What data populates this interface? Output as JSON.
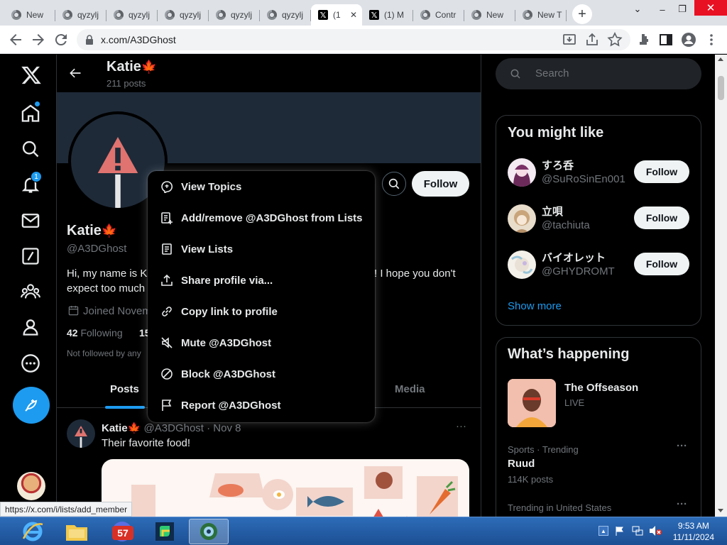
{
  "browser": {
    "tabs": [
      {
        "label": "New",
        "icon": "chrome-icon"
      },
      {
        "label": "qyzylj",
        "icon": "chrome-icon"
      },
      {
        "label": "qyzylj",
        "icon": "chrome-icon"
      },
      {
        "label": "qyzylj",
        "icon": "chrome-icon"
      },
      {
        "label": "qyzylj",
        "icon": "chrome-icon"
      },
      {
        "label": "qyzylj",
        "icon": "chrome-icon"
      },
      {
        "label": "(1",
        "icon": "x-icon",
        "active": true
      },
      {
        "label": "(1) M",
        "icon": "x-icon"
      },
      {
        "label": "Contr",
        "icon": "chrome-icon"
      },
      {
        "label": "New",
        "icon": "chrome-icon"
      },
      {
        "label": "New T",
        "icon": "chrome-icon"
      }
    ],
    "url": "x.com/A3DGhost",
    "status_url": "https://x.com/i/lists/add_member"
  },
  "nav": {
    "notifications_badge": "1"
  },
  "profile": {
    "header_name": "Katie",
    "flag": "🍁",
    "posts_count": "211 posts",
    "name": "Katie",
    "handle": "@A3DGhost",
    "bio_start": "Hi, my name is Ka",
    "bio_end": "! I hope you don't",
    "bio_line2": "expect too much",
    "joined": "Joined Novem",
    "following_count": "42",
    "following_label": "Following",
    "followers_partial": "15",
    "not_followed": "Not followed by any",
    "follow_label": "Follow"
  },
  "profile_tabs": {
    "posts": "Posts",
    "media": "Media"
  },
  "post": {
    "author": "Katie",
    "flag": "🍁",
    "meta": "@A3DGhost · Nov 8",
    "text": "Their favorite food!",
    "more": "···"
  },
  "menu": {
    "items": [
      {
        "label": "View Topics",
        "icon": "topics-icon"
      },
      {
        "label": "Add/remove @A3DGhost from Lists",
        "icon": "list-add-icon"
      },
      {
        "label": "View Lists",
        "icon": "list-icon"
      },
      {
        "label": "Share profile via...",
        "icon": "share-icon"
      },
      {
        "label": "Copy link to profile",
        "icon": "link-icon"
      },
      {
        "label": "Mute @A3DGhost",
        "icon": "mute-icon"
      },
      {
        "label": "Block @A3DGhost",
        "icon": "block-icon"
      },
      {
        "label": "Report @A3DGhost",
        "icon": "flag-icon"
      }
    ]
  },
  "sidebar": {
    "search_placeholder": "Search",
    "might_like_title": "You might like",
    "suggestions": [
      {
        "name": "すろ呑",
        "handle": "@SuRoSinEn001",
        "button": "Follow"
      },
      {
        "name": "立唄",
        "handle": "@tachiuta",
        "button": "Follow"
      },
      {
        "name": "バイオレット",
        "handle": "@GHYDROMT",
        "button": "Follow"
      }
    ],
    "show_more": "Show more",
    "happening_title": "What’s happening",
    "featured": {
      "title": "The Offseason",
      "status": "LIVE"
    },
    "trends": [
      {
        "context": "Sports · Trending",
        "name": "Ruud",
        "posts": "114K posts"
      },
      {
        "context": "Trending in United States",
        "name": "",
        "posts": ""
      }
    ],
    "more": "···"
  },
  "taskbar": {
    "badge_57": "57",
    "time": "9:53 AM",
    "date": "11/11/2024"
  },
  "colors": {
    "accent": "#1d9bf0",
    "banner": "#1e2a38",
    "warning_red": "#e0736f"
  }
}
